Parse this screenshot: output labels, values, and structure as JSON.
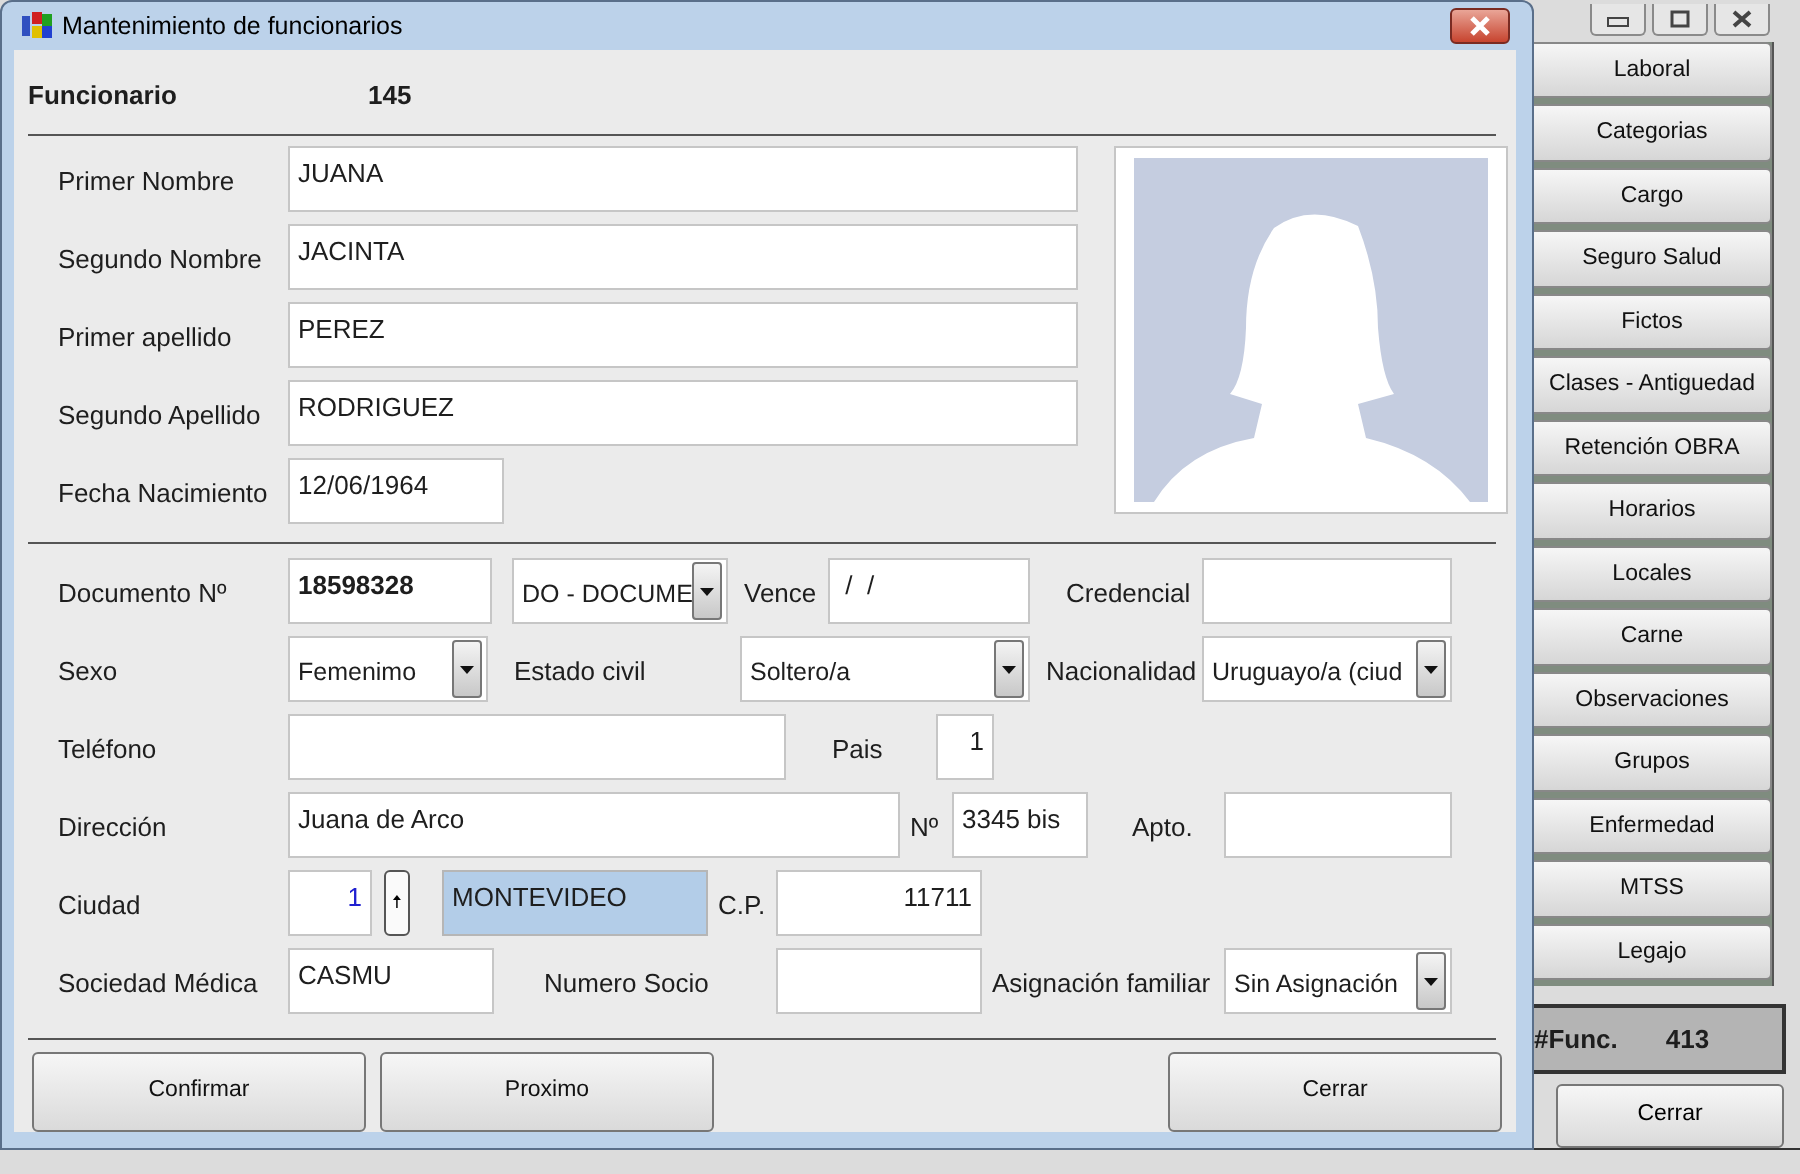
{
  "window": {
    "title": "Mantenimiento de funcionarios"
  },
  "header": {
    "label": "Funcionario",
    "value": "145"
  },
  "personal_fields": [
    {
      "label": "Primer Nombre",
      "value": "JUANA"
    },
    {
      "label": "Segundo Nombre",
      "value": "JACINTA"
    },
    {
      "label": "Primer apellido",
      "value": "PEREZ"
    },
    {
      "label": "Segundo Apellido",
      "value": "RODRIGUEZ"
    },
    {
      "label": "Fecha Nacimiento",
      "value": "12/06/1964"
    }
  ],
  "detail_rows": [
    [
      {
        "kind": "label",
        "text": "Documento Nº"
      },
      {
        "kind": "strong",
        "value": "18598328"
      },
      {
        "kind": "select",
        "value": "DO - DOCUME"
      },
      {
        "kind": "label",
        "text": "Vence"
      },
      {
        "kind": "text",
        "value": " /  /"
      },
      {
        "kind": "label",
        "text": "Credencial"
      },
      {
        "kind": "text"
      }
    ],
    [
      {
        "kind": "label",
        "text": "Sexo"
      },
      {
        "kind": "select",
        "value": "Femenimo"
      },
      {
        "kind": "label",
        "text": "Estado civil"
      },
      {
        "kind": "select",
        "value": "Soltero/a"
      },
      {
        "kind": "label",
        "text": "Nacionalidad"
      },
      {
        "kind": "select",
        "value": "Uruguayo/a (ciud"
      }
    ],
    [
      {
        "kind": "label",
        "text": "Teléfono"
      },
      {
        "kind": "text"
      },
      {
        "kind": "label",
        "text": "Pais"
      },
      {
        "kind": "number",
        "value": "1"
      }
    ],
    [
      {
        "kind": "label",
        "text": "Dirección"
      },
      {
        "kind": "text",
        "value": "Juana de Arco"
      },
      {
        "kind": "label",
        "text": "Nº"
      },
      {
        "kind": "text",
        "value": "3345 bis"
      },
      {
        "kind": "label",
        "text": "Apto."
      },
      {
        "kind": "text"
      }
    ],
    [
      {
        "kind": "label",
        "text": "Ciudad"
      },
      {
        "kind": "code",
        "value": "1"
      },
      {
        "kind": "up-button",
        "text": "🠅"
      },
      {
        "kind": "lookup",
        "value": "MONTEVIDEO"
      },
      {
        "kind": "label",
        "text": "C.P."
      },
      {
        "kind": "number",
        "value": "11711"
      }
    ],
    [
      {
        "kind": "label",
        "text": "Sociedad Médica"
      },
      {
        "kind": "text",
        "value": "CASMU"
      },
      {
        "kind": "label",
        "text": "Numero Socio"
      },
      {
        "kind": "text"
      },
      {
        "kind": "label",
        "text": "Asignación familiar"
      },
      {
        "kind": "select",
        "value": "Sin Asignación"
      }
    ]
  ],
  "dialog_buttons": [
    "Confirmar",
    "Proximo",
    "Cerrar"
  ],
  "side_buttons": [
    "Laboral",
    "Categorias",
    "Cargo",
    "Seguro Salud",
    "Fictos",
    "Clases - Antiguedad",
    "Retención OBRA",
    "Horarios",
    "Locales",
    "Carne",
    "Observaciones",
    "Grupos",
    "Enfermedad",
    "MTSS",
    "Legajo"
  ],
  "counter": {
    "label": "#Func.",
    "value": "413"
  },
  "main_button": "Cerrar"
}
